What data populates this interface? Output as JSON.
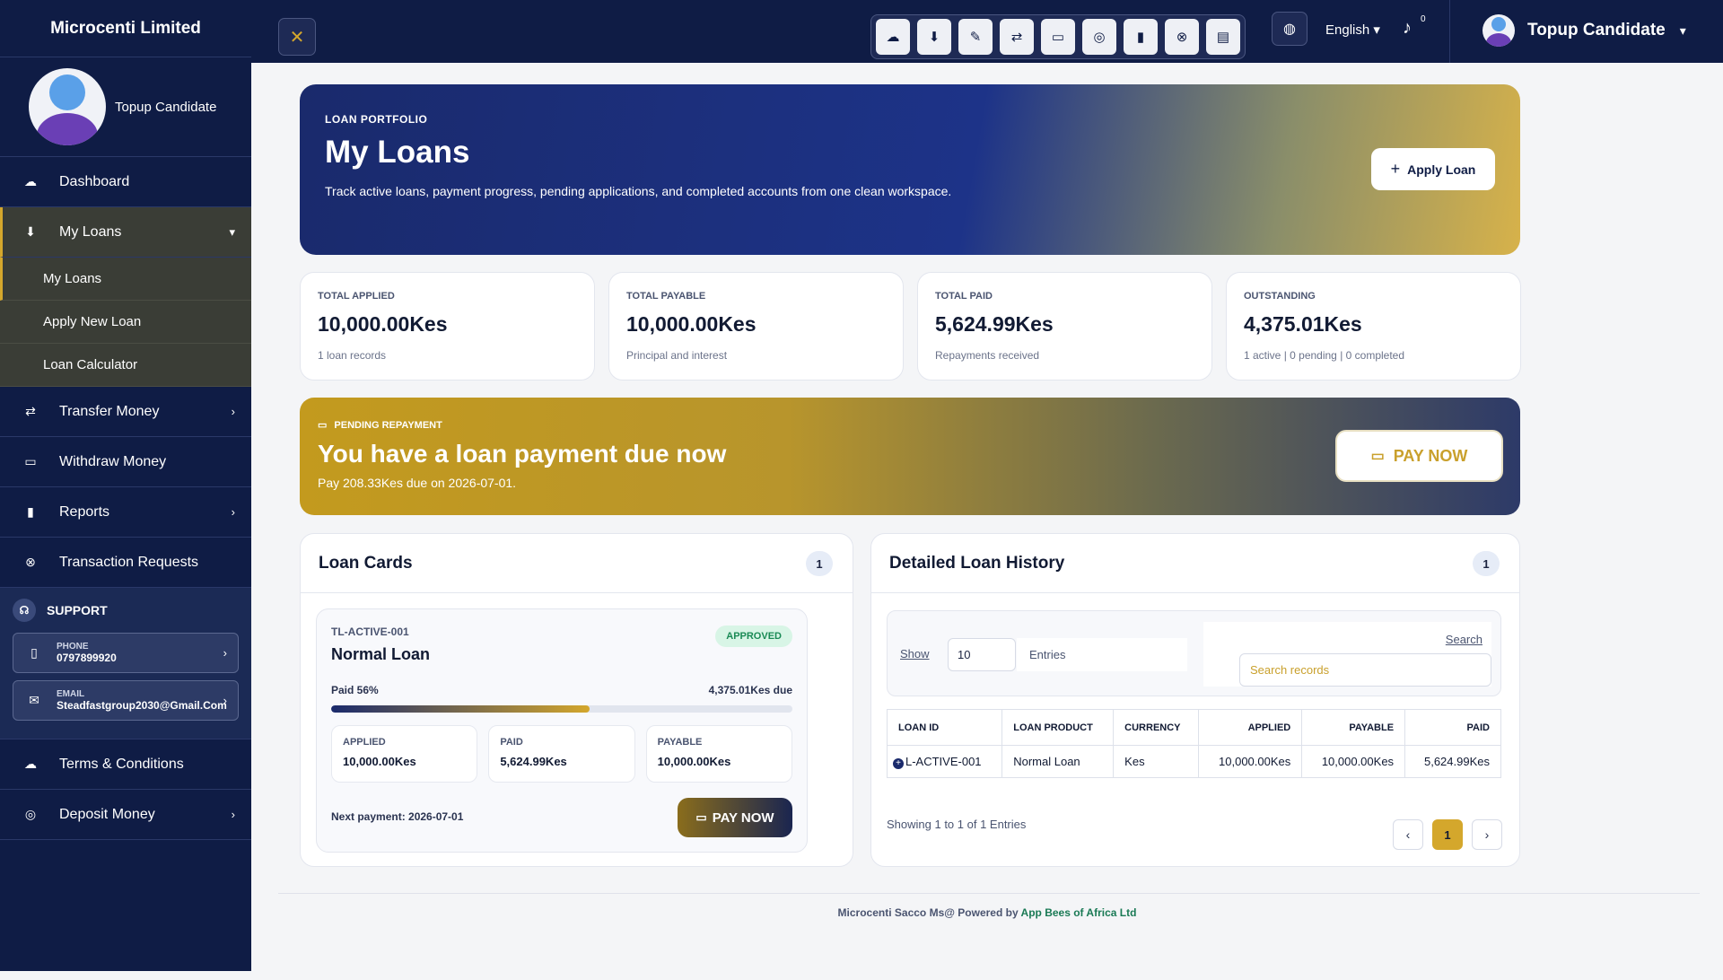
{
  "sidebar": {
    "brand": "Microcenti Limited",
    "profile_name": "Topup Candidate",
    "nav": {
      "dashboard": "Dashboard",
      "my_loans": "My Loans",
      "my_loans_sub": [
        "My Loans",
        "Apply New Loan",
        "Loan Calculator"
      ],
      "transfer": "Transfer Money",
      "withdraw": "Withdraw Money",
      "reports": "Reports",
      "transaction_requests": "Transaction Requests",
      "terms": "Terms & Conditions",
      "deposit": "Deposit Money"
    },
    "support": {
      "title": "SUPPORT",
      "phone_label": "PHONE",
      "phone": "0797899920",
      "email_label": "EMAIL",
      "email": "Steadfastgroup2030@Gmail.Com"
    }
  },
  "topbar": {
    "language": "English",
    "notification_count": "0",
    "user_name": "Topup Candidate",
    "quick_icons": [
      "dashboard-icon",
      "loan-icon",
      "apply-icon",
      "transfer-icon",
      "card-icon",
      "coins-icon",
      "reports-icon",
      "requests-icon",
      "clipboard-icon"
    ]
  },
  "hero": {
    "kicker": "LOAN PORTFOLIO",
    "title": "My Loans",
    "description": "Track active loans, payment progress, pending applications, and completed accounts from one clean workspace.",
    "apply_button": "Apply Loan"
  },
  "stats": [
    {
      "label": "TOTAL APPLIED",
      "value": "10,000.00Kes",
      "sub": "1 loan records"
    },
    {
      "label": "TOTAL PAYABLE",
      "value": "10,000.00Kes",
      "sub": "Principal and interest"
    },
    {
      "label": "TOTAL PAID",
      "value": "5,624.99Kes",
      "sub": "Repayments received"
    },
    {
      "label": "OUTSTANDING",
      "value": "4,375.01Kes",
      "sub": "1 active | 0 pending | 0 completed"
    }
  ],
  "pending": {
    "kicker": "PENDING REPAYMENT",
    "title": "You have a loan payment due now",
    "subtitle": "Pay 208.33Kes due on 2026-07-01.",
    "button": "PAY NOW"
  },
  "loan_cards": {
    "title": "Loan Cards",
    "count": "1",
    "card": {
      "id": "TL-ACTIVE-001",
      "status": "APPROVED",
      "name": "Normal Loan",
      "paid_label": "Paid 56%",
      "paid_fraction": 0.56,
      "due": "4,375.01Kes due",
      "applied_label": "APPLIED",
      "applied": "10,000.00Kes",
      "paid_label2": "PAID",
      "paid": "5,624.99Kes",
      "payable_label": "PAYABLE",
      "payable": "10,000.00Kes",
      "next_payment": "Next payment: 2026-07-01",
      "button": "PAY NOW"
    }
  },
  "history": {
    "title": "Detailed Loan History",
    "count": "1",
    "show_label": "Show",
    "show_value": "10",
    "entries_label": "Entries",
    "search_label": "Search",
    "search_placeholder": "Search records",
    "columns": [
      "LOAN ID",
      "LOAN PRODUCT",
      "CURRENCY",
      "APPLIED",
      "PAYABLE",
      "PAID"
    ],
    "rows": [
      [
        "L-ACTIVE-001",
        "Normal Loan",
        "Kes",
        "10,000.00Kes",
        "10,000.00Kes",
        "5,624.99Kes"
      ]
    ],
    "info": "Showing 1 to 1 of 1 Entries",
    "current_page": "1",
    "prev": "‹",
    "next": "›"
  },
  "footer": {
    "text": "Microcenti Sacco Ms@ Powered by",
    "brand": "App Bees of Africa Ltd"
  },
  "colors": {
    "navy": "#0f1c45",
    "gold": "#d4a72c",
    "approved_green": "#1a8a55"
  }
}
